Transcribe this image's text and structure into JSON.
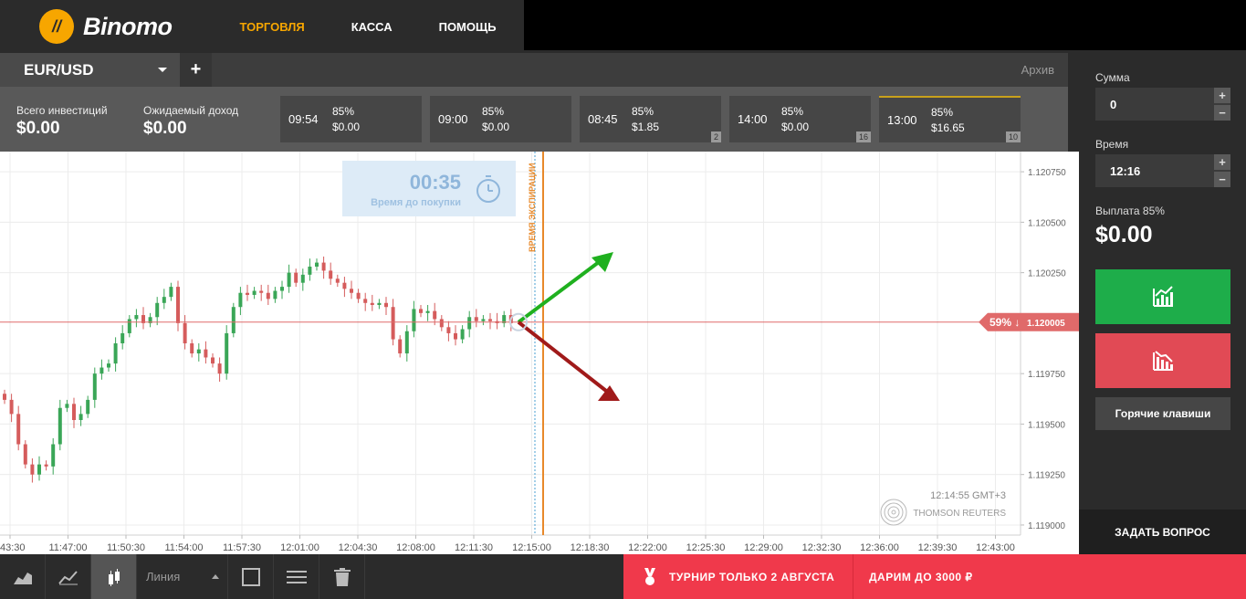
{
  "brand": {
    "name": "Binomo",
    "mark": "//"
  },
  "nav": [
    {
      "label": "ТОРГОВЛЯ",
      "active": true
    },
    {
      "label": "КАССА",
      "active": false
    },
    {
      "label": "ПОМОЩЬ",
      "active": false
    }
  ],
  "asset_tab": {
    "label": "EUR/USD",
    "add_label": "+",
    "archive_label": "Архив"
  },
  "info": {
    "invest_label": "Всего инвестиций",
    "invest_value": "$0.00",
    "income_label": "Ожидаемый доход",
    "income_value": "$0.00"
  },
  "deals": [
    {
      "time": "09:54",
      "pct": "85%",
      "sum": "$0.00",
      "count": ""
    },
    {
      "time": "09:00",
      "pct": "85%",
      "sum": "$0.00",
      "count": ""
    },
    {
      "time": "08:45",
      "pct": "85%",
      "sum": "$1.85",
      "count": "2"
    },
    {
      "time": "14:00",
      "pct": "85%",
      "sum": "$0.00",
      "count": "16"
    },
    {
      "time": "13:00",
      "pct": "85%",
      "sum": "$16.65",
      "count": "10"
    }
  ],
  "timer": {
    "value": "00:35",
    "label": "Время до покупки"
  },
  "expiry_label": "ВРЕМЯ ЭКСПИРАЦИИ",
  "current_price": {
    "badge": "59% ↓",
    "value": "1.120005"
  },
  "timestamp": "12:14:55 GMT+3",
  "provider": "THOMSON REUTERS",
  "chart_data": {
    "type": "candlestick",
    "y_ticks": [
      "1.120750",
      "1.120500",
      "1.120250",
      "1.119750",
      "1.119500",
      "1.119250",
      "1.119000"
    ],
    "x_ticks": [
      "43:30",
      "11:47:00",
      "11:50:30",
      "11:54:00",
      "11:57:30",
      "12:01:00",
      "12:04:30",
      "12:08:00",
      "12:11:30",
      "12:15:00",
      "12:18:30",
      "12:22:00",
      "12:25:30",
      "12:29:00",
      "12:32:30",
      "12:36:00",
      "12:39:30",
      "12:43:00"
    ],
    "ylim": [
      1.11895,
      1.12085
    ],
    "candles": [
      1.11962,
      1.11955,
      1.1194,
      1.1193,
      1.11925,
      1.1193,
      1.11929,
      1.1194,
      1.11958,
      1.1196,
      1.11952,
      1.11955,
      1.11962,
      1.11975,
      1.11978,
      1.1198,
      1.1199,
      1.11995,
      1.12002,
      1.12004,
      1.12,
      1.12003,
      1.1201,
      1.12013,
      1.12018,
      1.12,
      1.1199,
      1.11985,
      1.11987,
      1.11983,
      1.1198,
      1.11975,
      1.11995,
      1.12008,
      1.12015,
      1.12014,
      1.12016,
      1.12015,
      1.12012,
      1.12016,
      1.12018,
      1.12025,
      1.1202,
      1.12024,
      1.12028,
      1.1203,
      1.12026,
      1.12022,
      1.1202,
      1.12017,
      1.12015,
      1.12012,
      1.1201,
      1.12009,
      1.1201,
      1.12008,
      1.11992,
      1.11985,
      1.11996,
      1.12007,
      1.12005,
      1.12006,
      1.12002,
      1.11998,
      1.11995,
      1.11992,
      1.11997,
      1.12003,
      1.12001,
      1.12002,
      1.12001,
      1.12,
      1.12004,
      1.12
    ],
    "current": 1.120005
  },
  "right": {
    "sum_label": "Сумма",
    "sum_value": "0",
    "time_label": "Время",
    "time_value": "12:16",
    "payout_label": "Выплата 85%",
    "payout_value": "$0.00",
    "hotkeys_label": "Горячие клавиши",
    "ask_label": "ЗАДАТЬ ВОПРОС"
  },
  "bottom": {
    "line_label": "Линия",
    "promo1": "ТУРНИР ТОЛЬКО 2 АВГУСТА",
    "promo2": "ДАРИМ ДО 3000 ₽"
  },
  "colors": {
    "accent": "#f7a600",
    "up": "#1ead4a",
    "down": "#e14a55",
    "promo": "#f0394b"
  }
}
